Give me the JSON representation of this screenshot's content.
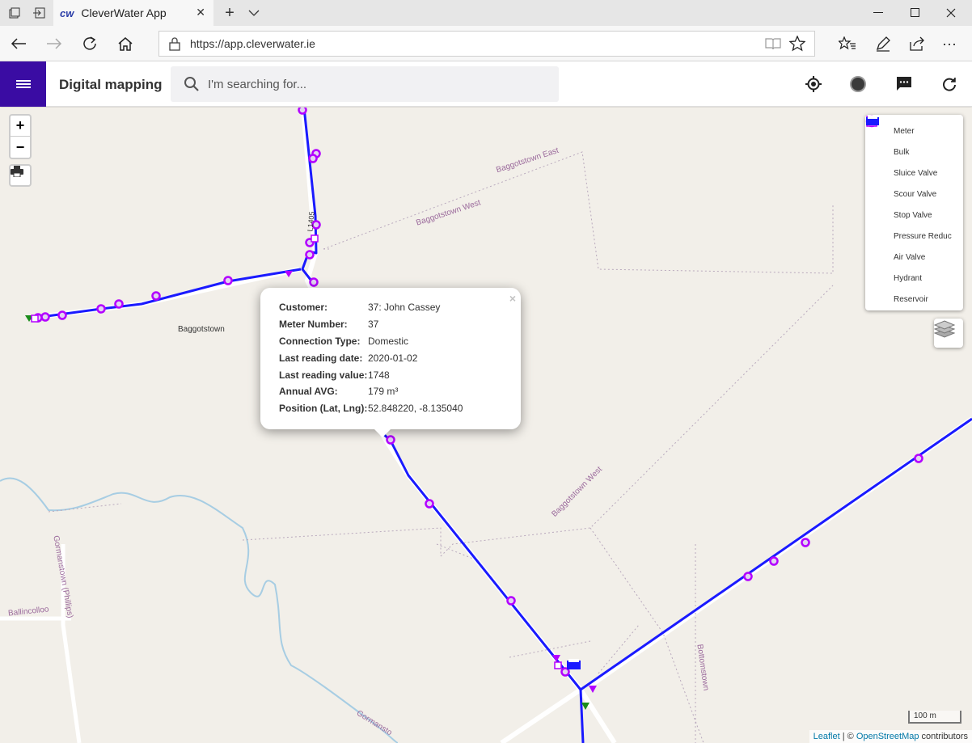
{
  "browser": {
    "tab_title": "CleverWater App",
    "tab_logo": "cw",
    "url": "https://app.cleverwater.ie"
  },
  "appbar": {
    "title": "Digital mapping",
    "search_placeholder": "I'm searching for..."
  },
  "map": {
    "zoom_in": "+",
    "zoom_out": "−",
    "labels": {
      "baggotstown_east": "Baggotstown East",
      "baggotstown_west_1": "Baggotstown West",
      "baggotstown_west_2": "Baggotstown West",
      "baggotstown": "Baggotstown",
      "gormanstown_phillips": "Gormanstown (Phillips)",
      "ballincolloo": "Ballincolloo",
      "bottomstown": "Bottomstown",
      "gormanstown_lower": "Gormansto",
      "road_ref": "L1405"
    },
    "scale": "100 m",
    "attribution": {
      "leaflet": "Leaflet",
      "separator": " | © ",
      "osm": "OpenStreetMap",
      "contributors": " contributors"
    }
  },
  "legend": {
    "items": [
      {
        "label": "Meter",
        "icon": "meter-icon"
      },
      {
        "label": "Bulk",
        "icon": "bulk-icon"
      },
      {
        "label": "Sluice Valve",
        "icon": "sluice-valve-icon"
      },
      {
        "label": "Scour Valve",
        "icon": "scour-valve-icon"
      },
      {
        "label": "Stop Valve",
        "icon": "stop-valve-icon"
      },
      {
        "label": "Pressure Reduc",
        "icon": "pressure-reducing-valve-icon"
      },
      {
        "label": "Air Valve",
        "icon": "air-valve-icon"
      },
      {
        "label": "Hydrant",
        "icon": "hydrant-icon"
      },
      {
        "label": "Reservoir",
        "icon": "reservoir-icon"
      }
    ]
  },
  "popup": {
    "close": "×",
    "rows": [
      {
        "key": "Customer:",
        "value": "37: John Cassey"
      },
      {
        "key": "Meter Number:",
        "value": "37"
      },
      {
        "key": "Connection Type:",
        "value": "Domestic"
      },
      {
        "key": "Last reading date:",
        "value": "2020-01-02"
      },
      {
        "key": "Last reading value:",
        "value": "1748"
      },
      {
        "key": "Annual AVG:",
        "value": "179 m³"
      },
      {
        "key": "Position (Lat, Lng):",
        "value": "52.848220, -8.135040"
      }
    ]
  },
  "colors": {
    "pipe": "#1a1aff",
    "meter": "#b300ff",
    "app_accent": "#3a0ca3",
    "scour": "#1a8c1a",
    "stop": "#e01b3c",
    "pressure": "#2a8cff"
  }
}
